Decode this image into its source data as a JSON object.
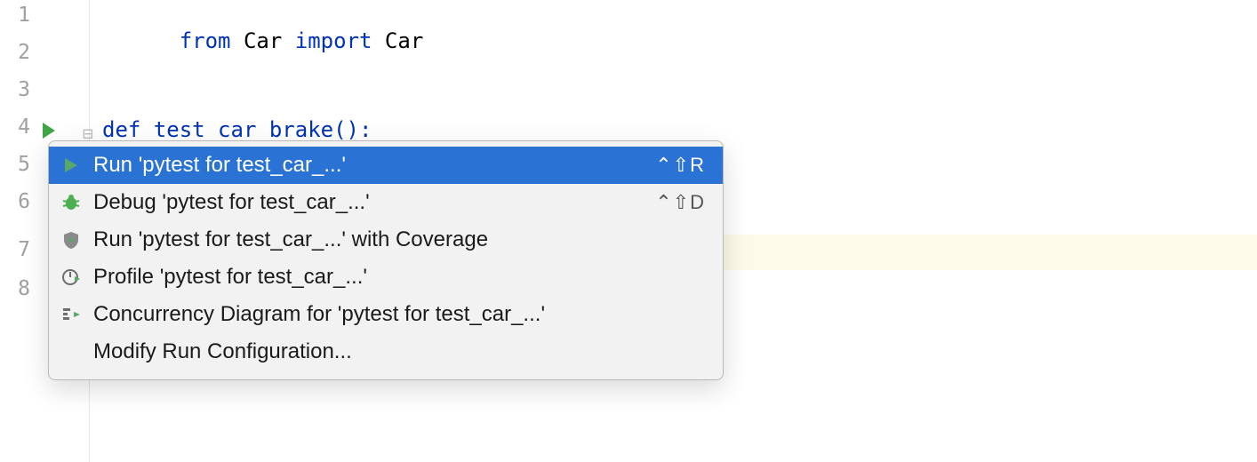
{
  "editor": {
    "lines": [
      "1",
      "2",
      "3",
      "4",
      "5",
      "6",
      "7",
      "8"
    ],
    "code": {
      "kw_from": "from",
      "mod": "Car",
      "kw_import": "import",
      "name": "Car",
      "def_line": "def test_car_brake():"
    }
  },
  "menu": {
    "items": [
      {
        "label": "Run 'pytest for test_car_...'",
        "shortcut": "⌃⇧R",
        "icon": "run",
        "selected": true
      },
      {
        "label": "Debug 'pytest for test_car_...'",
        "shortcut": "⌃⇧D",
        "icon": "debug",
        "selected": false
      },
      {
        "label": "Run 'pytest for test_car_...' with Coverage",
        "shortcut": "",
        "icon": "coverage",
        "selected": false
      },
      {
        "label": "Profile 'pytest for test_car_...'",
        "shortcut": "",
        "icon": "profile",
        "selected": false
      },
      {
        "label": "Concurrency Diagram for 'pytest for test_car_...'",
        "shortcut": "",
        "icon": "concurrency",
        "selected": false
      },
      {
        "label": "Modify Run Configuration...",
        "shortcut": "",
        "icon": "none",
        "selected": false
      }
    ]
  }
}
